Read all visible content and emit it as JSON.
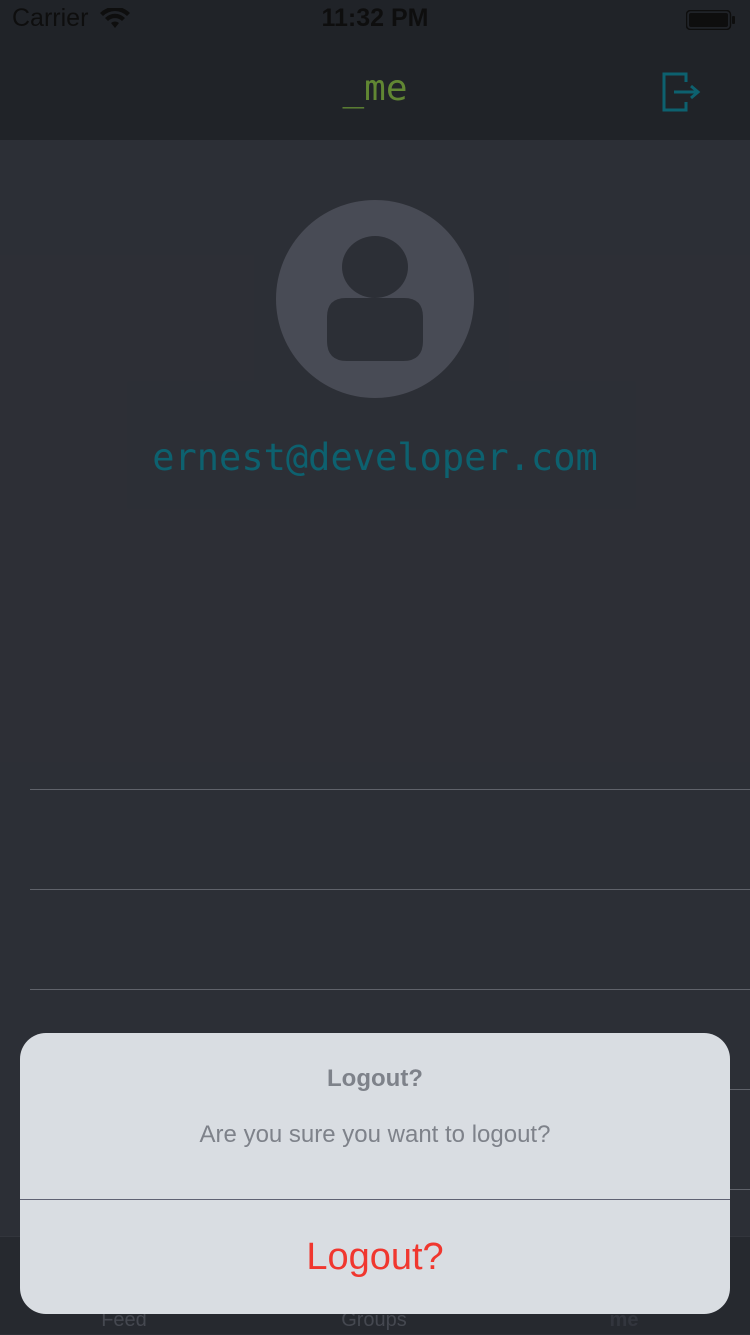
{
  "status_bar": {
    "carrier": "Carrier",
    "time": "11:32 PM",
    "wifi_icon": "wifi-icon",
    "battery_icon": "battery-icon"
  },
  "nav": {
    "title": "_me",
    "logout_icon": "logout-icon",
    "title_color": "#6f9a3b",
    "icon_color": "#0f6f7f"
  },
  "profile": {
    "avatar_icon": "person-icon",
    "email": "ernest@developer.com",
    "email_color": "#0f6f7f"
  },
  "tabs": [
    {
      "label": "Feed"
    },
    {
      "label": "Groups"
    },
    {
      "label": "me"
    }
  ],
  "dialog": {
    "title": "Logout?",
    "message": "Are you sure you want to logout?",
    "action_label": "Logout?",
    "action_color": "#f0372f"
  }
}
